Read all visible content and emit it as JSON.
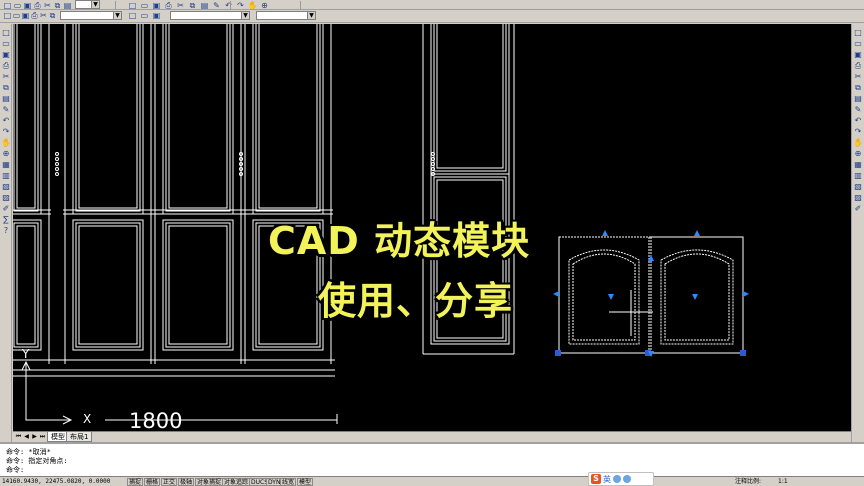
{
  "title_overlay": {
    "line1": "CAD 动态模块",
    "line2": "使用、分享"
  },
  "drawing": {
    "dimension_text": "1800",
    "x_axis_label": "X",
    "y_axis_label": "Y"
  },
  "layout_tabs": {
    "items": [
      "模型",
      "布局1"
    ],
    "active": 0
  },
  "command_window": {
    "lines": [
      "命令: *取消*",
      "命令: 指定对角点:",
      "命令:"
    ]
  },
  "status_bar": {
    "coordinates": "14160.9430, 22475.0820, 0.0000",
    "buttons": [
      "捕捉",
      "栅格",
      "正交",
      "极轴",
      "对象捕捉",
      "对象追踪",
      "DUCS",
      "DYN",
      "线宽",
      "模型"
    ],
    "annotation_scale_label": "注释比例:",
    "annotation_scale_value": "1:1"
  },
  "ime": {
    "lang": "英"
  },
  "colors": {
    "canvas": "#000000",
    "lines": "#ffffff",
    "grip": "#2a8cff",
    "title": "#f2f25a",
    "chrome": "#d4d0c8"
  },
  "icons": {
    "top_toolbar": [
      "new-icon",
      "open-icon",
      "save-icon",
      "print-icon",
      "cut-icon",
      "copy-icon",
      "paste-icon",
      "match-icon",
      "undo-icon",
      "redo-icon",
      "pan-icon",
      "zoom-icon",
      "properties-icon",
      "design-center-icon",
      "tool-palette-icon",
      "sheet-set-icon",
      "markup-icon",
      "calc-icon",
      "help-icon"
    ],
    "left_draw": [
      "line-icon",
      "construction-line-icon",
      "polyline-icon",
      "polygon-icon",
      "rectangle-icon",
      "arc-icon",
      "circle-icon",
      "revcloud-icon",
      "spline-icon",
      "ellipse-icon",
      "ellipse-arc-icon",
      "insert-block-icon",
      "make-block-icon",
      "point-icon",
      "hatch-icon",
      "gradient-icon",
      "region-icon",
      "table-icon",
      "mtext-icon"
    ],
    "right_modify": [
      "erase-icon",
      "copy-object-icon",
      "mirror-icon",
      "offset-icon",
      "array-icon",
      "move-icon",
      "rotate-icon",
      "scale-icon",
      "stretch-icon",
      "trim-icon",
      "extend-icon",
      "break-point-icon",
      "break-icon",
      "join-icon",
      "chamfer-icon",
      "fillet-icon",
      "explode-icon"
    ]
  }
}
